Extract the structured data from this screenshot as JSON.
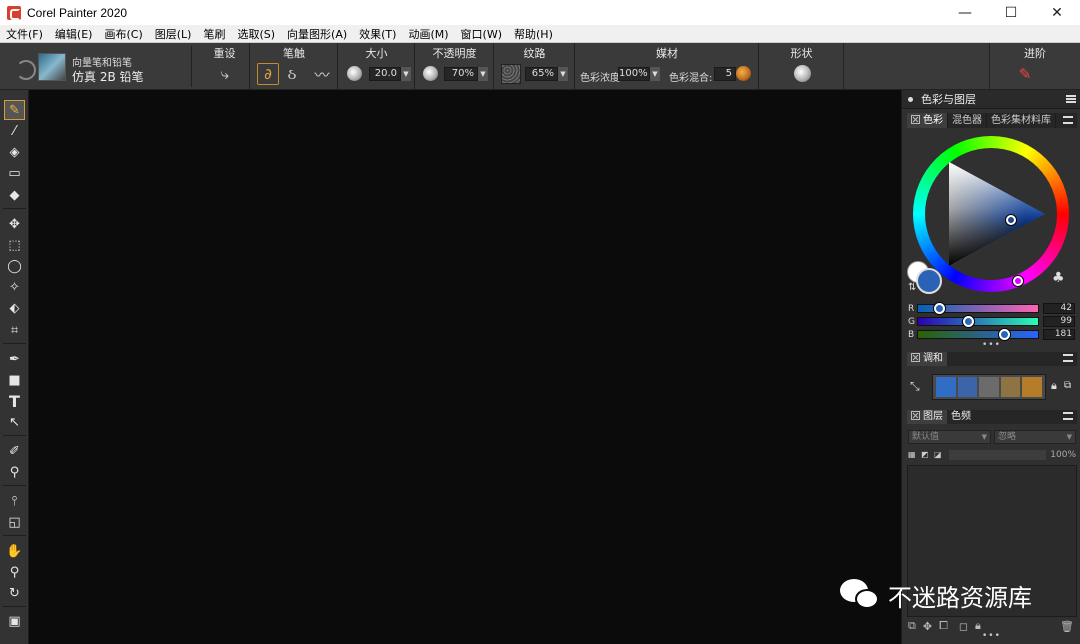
{
  "window": {
    "title": "Corel Painter 2020",
    "minimize": "—",
    "maximize": "☐",
    "close": "✕"
  },
  "menu": [
    "文件(F)",
    "编辑(E)",
    "画布(C)",
    "图层(L)",
    "笔刷",
    "选取(S)",
    "向量图形(A)",
    "效果(T)",
    "动画(M)",
    "窗口(W)",
    "帮助(H)"
  ],
  "propbar": {
    "brush_category": "向量笔和铅笔",
    "brush_variant": "仿真 2B 铅笔",
    "reset_label": "重设",
    "stroke_label": "笔触",
    "size_label": "大小",
    "size_value": "20.0",
    "opacity_label": "不透明度",
    "opacity_value": "70%",
    "grain_label": "纹路",
    "grain_value": "65%",
    "media_label": "媒材",
    "color_density_label": "色彩浓度:",
    "color_density_value": "100%",
    "color_blend_label": "色彩混合:",
    "color_blend_value": "5",
    "shape_label": "形状",
    "advanced_label": "进阶"
  },
  "panel": {
    "title": "色彩与图层",
    "color_tabs": [
      "色彩",
      "混色器",
      "色彩集材料库"
    ],
    "current_color": "#2a63b5",
    "rgb": [
      {
        "label": "R",
        "value": "42"
      },
      {
        "label": "G",
        "value": "99"
      },
      {
        "label": "B",
        "value": "181"
      }
    ],
    "more": "•••",
    "harmony_title": "调和",
    "harmony_swatches": [
      "#2f6ec4",
      "#3c64a8",
      "#6b6b6b",
      "#8e7444",
      "#b57d2a"
    ],
    "layers_tabs": [
      "图层",
      "色频"
    ],
    "composite_method": "默认值",
    "composite_depth": "忽略",
    "layer_opacity": "100%"
  },
  "watermark": {
    "text": "不迷路资源库"
  }
}
